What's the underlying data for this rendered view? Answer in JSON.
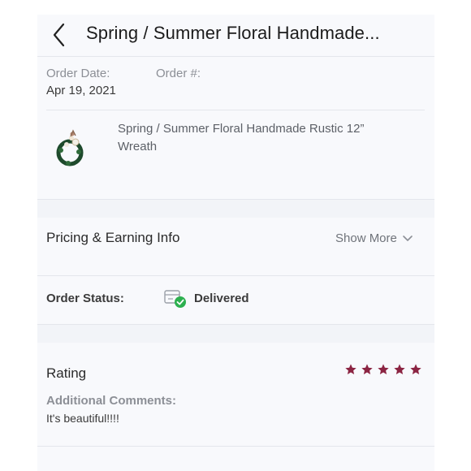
{
  "header": {
    "title": "Spring / Summer Floral Handmade..."
  },
  "order": {
    "date_label": "Order Date:",
    "date_value": "Apr 19, 2021",
    "number_label": "Order #:"
  },
  "product": {
    "name": "Spring / Summer Floral Handmade Rustic 12” Wreath",
    "thumbnail_icon": "wreath-thumbnail"
  },
  "pricing": {
    "title": "Pricing & Earning Info",
    "show_more_label": "Show More"
  },
  "status": {
    "label": "Order Status:",
    "value": "Delivered",
    "icon": "delivered-box-icon"
  },
  "rating": {
    "title": "Rating",
    "stars": 5,
    "star_color": "#8b2442",
    "comments_label": "Additional Comments:",
    "comments_value": "It's beautiful!!!!"
  },
  "colors": {
    "accent": "#8b2442",
    "success": "#2db04f"
  }
}
